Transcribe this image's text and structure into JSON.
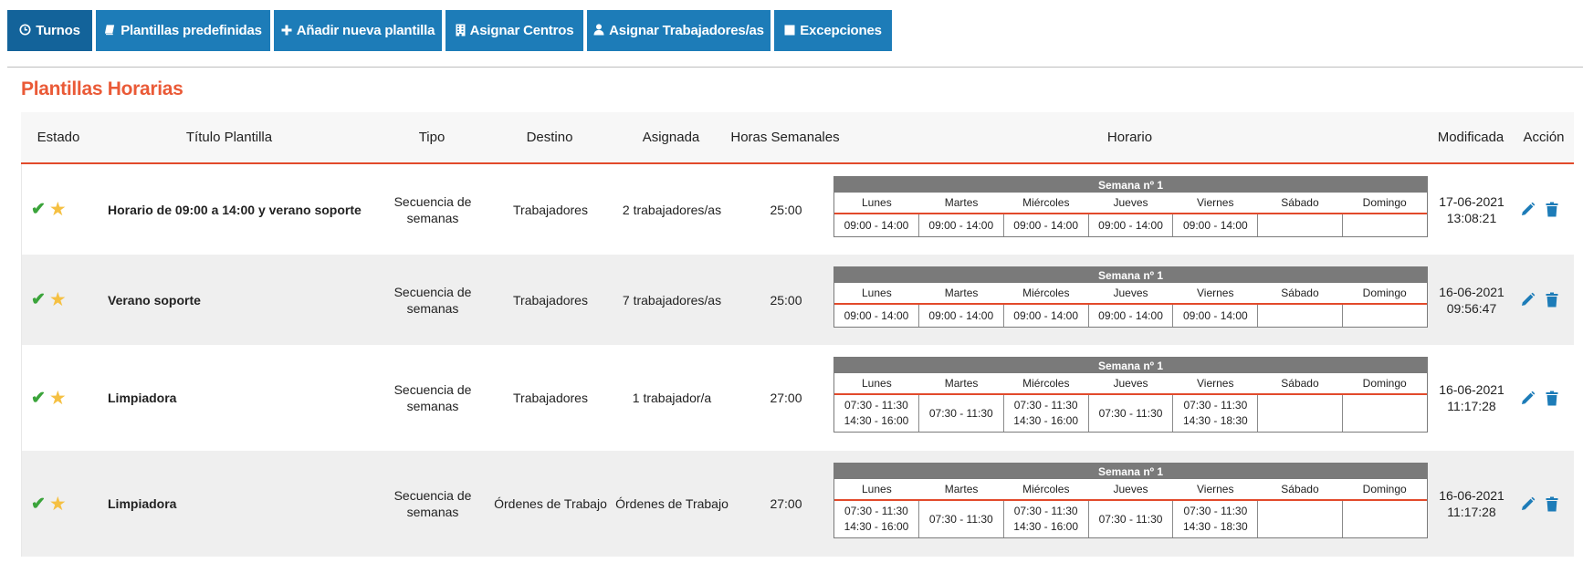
{
  "toolbar": {
    "buttons": [
      {
        "label": "Turnos",
        "icon": "clock-icon"
      },
      {
        "label": "Plantillas predefinidas",
        "icon": "book-icon"
      },
      {
        "label": "Añadir nueva plantilla",
        "icon": "plus-icon"
      },
      {
        "label": "Asignar Centros",
        "icon": "building-icon"
      },
      {
        "label": "Asignar Trabajadores/as",
        "icon": "user-icon"
      },
      {
        "label": "Excepciones",
        "icon": "square-icon"
      }
    ]
  },
  "page": {
    "title": "Plantillas Horarias"
  },
  "colors": {
    "primary": "#1d7cb8",
    "accent": "#ea5a37",
    "check": "#3ba43b",
    "star": "#f5c042",
    "action": "#1d7cb8"
  },
  "table": {
    "headers": {
      "estado": "Estado",
      "titulo": "Título Plantilla",
      "tipo": "Tipo",
      "destino": "Destino",
      "asignada": "Asignada",
      "horas": "Horas Semanales",
      "horario": "Horario",
      "modificada": "Modificada",
      "accion": "Acción"
    },
    "week_label": "Semana nº 1",
    "days": [
      "Lunes",
      "Martes",
      "Miércoles",
      "Jueves",
      "Viernes",
      "Sábado",
      "Domingo"
    ],
    "rows": [
      {
        "titulo": "Horario de 09:00 a 14:00 y verano soporte",
        "tipo": "Secuencia de semanas",
        "destino": "Trabajadores",
        "asignada": "2 trabajadores/as",
        "horas": "25:00",
        "modificada_fecha": "17-06-2021",
        "modificada_hora": "13:08:21",
        "horario": [
          [
            "09:00 - 14:00"
          ],
          [
            "09:00 - 14:00"
          ],
          [
            "09:00 - 14:00"
          ],
          [
            "09:00 - 14:00"
          ],
          [
            "09:00 - 14:00"
          ],
          [],
          []
        ]
      },
      {
        "titulo": "Verano soporte",
        "tipo": "Secuencia de semanas",
        "destino": "Trabajadores",
        "asignada": "7 trabajadores/as",
        "horas": "25:00",
        "modificada_fecha": "16-06-2021",
        "modificada_hora": "09:56:47",
        "horario": [
          [
            "09:00 - 14:00"
          ],
          [
            "09:00 - 14:00"
          ],
          [
            "09:00 - 14:00"
          ],
          [
            "09:00 - 14:00"
          ],
          [
            "09:00 - 14:00"
          ],
          [],
          []
        ]
      },
      {
        "titulo": "Limpiadora",
        "tipo": "Secuencia de semanas",
        "destino": "Trabajadores",
        "asignada": "1 trabajador/a",
        "horas": "27:00",
        "modificada_fecha": "16-06-2021",
        "modificada_hora": "11:17:28",
        "horario": [
          [
            "07:30 - 11:30",
            "14:30 - 16:00"
          ],
          [
            "07:30 - 11:30"
          ],
          [
            "07:30 - 11:30",
            "14:30 - 16:00"
          ],
          [
            "07:30 - 11:30"
          ],
          [
            "07:30 - 11:30",
            "14:30 - 18:30"
          ],
          [],
          []
        ]
      },
      {
        "titulo": "Limpiadora",
        "tipo": "Secuencia de semanas",
        "destino": "Órdenes de Trabajo",
        "asignada": "Órdenes de Trabajo",
        "horas": "27:00",
        "modificada_fecha": "16-06-2021",
        "modificada_hora": "11:17:28",
        "horario": [
          [
            "07:30 - 11:30",
            "14:30 - 16:00"
          ],
          [
            "07:30 - 11:30"
          ],
          [
            "07:30 - 11:30",
            "14:30 - 16:00"
          ],
          [
            "07:30 - 11:30"
          ],
          [
            "07:30 - 11:30",
            "14:30 - 18:30"
          ],
          [],
          []
        ]
      }
    ]
  }
}
